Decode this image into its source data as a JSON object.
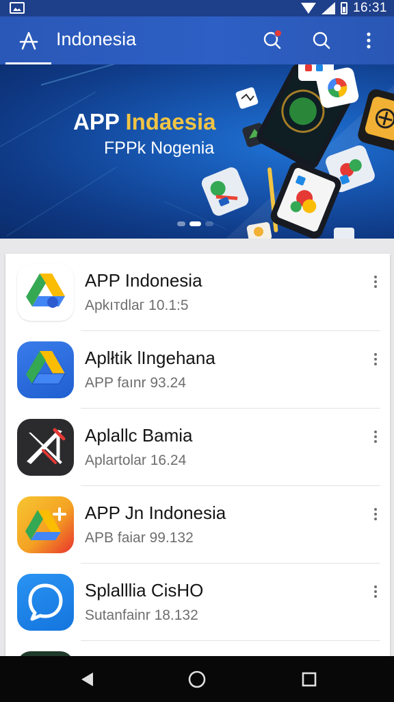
{
  "status_bar": {
    "time": "16:31"
  },
  "app_bar": {
    "title": "Indonesia",
    "logo_icon": "app-store-a-icon",
    "actions": [
      "notifications-icon",
      "search-icon",
      "more-vert-icon"
    ]
  },
  "banner": {
    "headline_part1": "APP ",
    "headline_part2": "Indaesia",
    "subline": "FPPk Nogenia",
    "page_count": 3,
    "active_page": 2
  },
  "apps": [
    {
      "name": "APP Indonesia",
      "meta": "Apkıтdlaг 10.1:5",
      "icon": "drive-triangle-icon"
    },
    {
      "name": "Aplłtik lIngehana",
      "meta": "APP faınr 93.24",
      "icon": "drive-triangle-blue-icon"
    },
    {
      "name": "Aplallc Bamia",
      "meta": "Aplartolar 16.24",
      "icon": "x-cross-icon"
    },
    {
      "name": "APP Jn Indonesia",
      "meta": "APB faiar 99.132",
      "icon": "drive-plus-icon"
    },
    {
      "name": "Splalllia CisHO",
      "meta": "Sutanfainr 18.132",
      "icon": "chat-bubble-icon"
    }
  ],
  "nav_bar": [
    "back-icon",
    "home-icon",
    "recents-icon"
  ],
  "colors": {
    "app_bar": "#2d5fc4",
    "status_bar": "#1e3f8a",
    "banner_accent": "#f2c443",
    "nav_bar": "#080808"
  }
}
